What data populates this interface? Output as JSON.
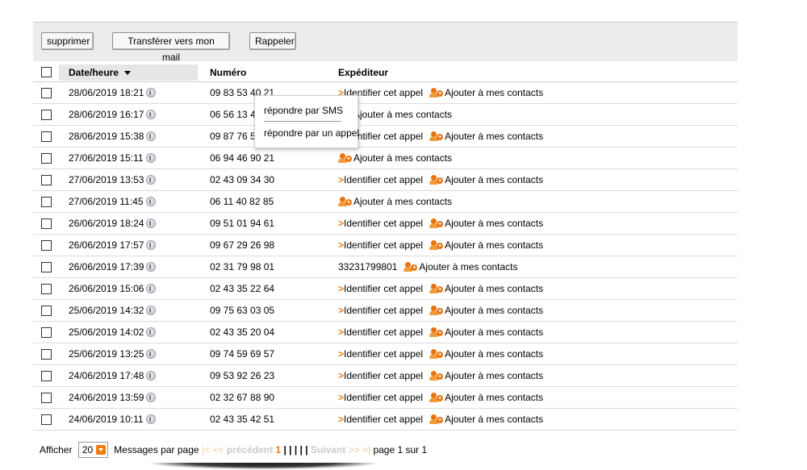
{
  "toolbar": {
    "delete_label": "supprimer",
    "transfer_label": "Transférer vers mon mail",
    "recall_label": "Rappeler"
  },
  "table": {
    "headers": {
      "date": "Date/heure",
      "number": "Numéro",
      "sender": "Expéditeur"
    },
    "identify_label": "Identifier cet appel",
    "add_contact_label": "Ajouter à mes contacts",
    "rows": [
      {
        "date": "28/06/2019 18:21",
        "number": "09 83 53 40 21",
        "sender": "identify"
      },
      {
        "date": "28/06/2019 16:17",
        "number": "06 56 13 40 52",
        "sender": ""
      },
      {
        "date": "28/06/2019 15:38",
        "number": "09 87 76 54 13",
        "sender": "identify"
      },
      {
        "date": "27/06/2019 15:11",
        "number": "06 94 46 90 21",
        "sender": ""
      },
      {
        "date": "27/06/2019 13:53",
        "number": "02 43 09 34 30",
        "sender": "identify"
      },
      {
        "date": "27/06/2019 11:45",
        "number": "06 11 40 82 85",
        "sender": ""
      },
      {
        "date": "26/06/2019 18:24",
        "number": "09 51 01 94 61",
        "sender": "identify"
      },
      {
        "date": "26/06/2019 17:57",
        "number": "09 67 29 26 98",
        "sender": "identify"
      },
      {
        "date": "26/06/2019 17:39",
        "number": "02 31 79 98 01",
        "sender": "33231799801"
      },
      {
        "date": "26/06/2019 15:06",
        "number": "02 43 35 22 64",
        "sender": "identify"
      },
      {
        "date": "25/06/2019 14:32",
        "number": "09 75 63 03 05",
        "sender": "identify"
      },
      {
        "date": "25/06/2019 14:02",
        "number": "02 43 35 20 04",
        "sender": "identify"
      },
      {
        "date": "25/06/2019 13:25",
        "number": "09 74 59 69 57",
        "sender": "identify"
      },
      {
        "date": "24/06/2019 17:48",
        "number": "09 53 92 26 23",
        "sender": "identify"
      },
      {
        "date": "24/06/2019 13:59",
        "number": "02 32 67 88 90",
        "sender": "identify"
      },
      {
        "date": "24/06/2019 10:11",
        "number": "02 43 35 42 51",
        "sender": "identify"
      }
    ]
  },
  "popup": {
    "sms_label": "répondre par SMS",
    "call_label": "répondre par un appel"
  },
  "pager": {
    "show_label": "Afficher",
    "per_page_value": "20",
    "per_page_suffix": "Messages par page",
    "first": "|<",
    "prev_arrows": "<<",
    "prev_label": "précédent",
    "current_page": "1",
    "separators": "| | | | |",
    "next_label": "Suivant",
    "next_arrows": ">>",
    "last": ">|",
    "page_info": "page 1 sur 1"
  },
  "colors": {
    "accent": "#f07b12",
    "toolbar_bg": "#ececec",
    "header_highlight": "#e6e6e6"
  }
}
